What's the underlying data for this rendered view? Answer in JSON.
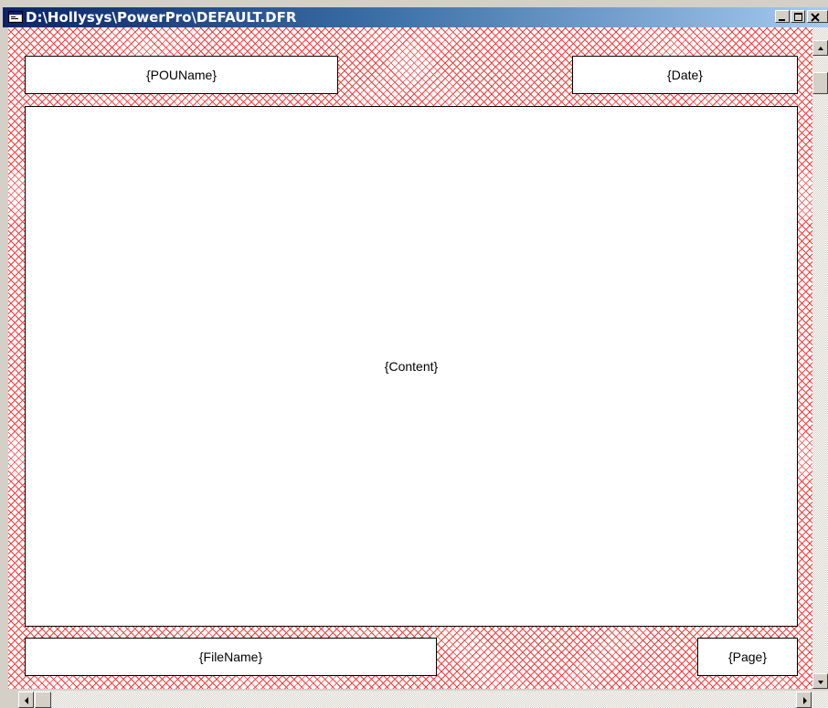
{
  "window": {
    "title": "D:\\Hollysys\\PowerPro\\DEFAULT.DFR",
    "icon": "document-window-icon"
  },
  "form": {
    "pou_name": "{POUName}",
    "date": "{Date}",
    "content": "{Content}",
    "file_name": "{FileName}",
    "page": "{Page}"
  },
  "colors": {
    "title_bar_start": "#0a246a",
    "title_bar_end": "#a6caf0",
    "hatch": "#ff3b3b",
    "face": "#d4d0c8"
  }
}
